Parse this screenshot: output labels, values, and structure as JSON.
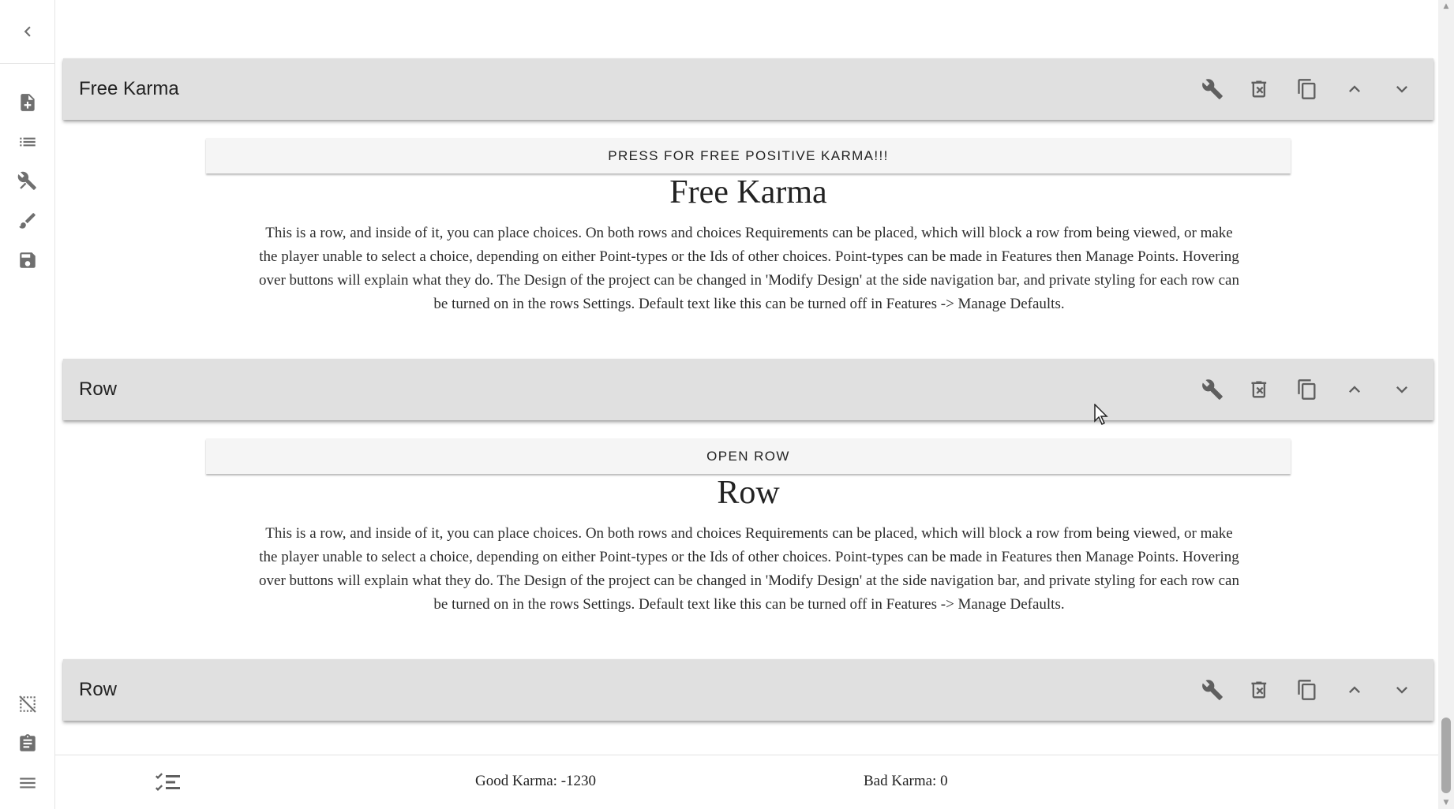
{
  "sidebar": {
    "collapse_icon": "chevron-left-icon",
    "items": [
      {
        "name": "create-project",
        "icon": "note-add-icon"
      },
      {
        "name": "row-list",
        "icon": "list-icon"
      },
      {
        "name": "features",
        "icon": "tools-icon"
      },
      {
        "name": "modify-design",
        "icon": "brush-icon"
      },
      {
        "name": "save",
        "icon": "save-icon"
      }
    ],
    "bottom_items": [
      {
        "name": "hide-images",
        "icon": "image-off-icon"
      },
      {
        "name": "clipboard",
        "icon": "clipboard-icon"
      },
      {
        "name": "menu",
        "icon": "menu-icon"
      }
    ]
  },
  "rows": [
    {
      "title": "Free Karma",
      "button_label": "PRESS FOR FREE POSITIVE KARMA!!!",
      "heading": "Free Karma",
      "text": "This is a row, and inside of it, you can place choices. On both rows and choices Requirements can be placed, which will block a row from being viewed, or make the player unable to select a choice, depending on either Point-types or the Ids of other choices. Point-types can be made in Features then Manage Points. Hovering over buttons will explain what they do. The Design of the project can be changed in 'Modify Design' at the side navigation bar, and private styling for each row can be turned on in the rows Settings. Default text like this can be turned off in Features -> Manage Defaults."
    },
    {
      "title": "Row",
      "button_label": "OPEN ROW",
      "heading": "Row",
      "text": "This is a row, and inside of it, you can place choices. On both rows and choices Requirements can be placed, which will block a row from being viewed, or make the player unable to select a choice, depending on either Point-types or the Ids of other choices. Point-types can be made in Features then Manage Points. Hovering over buttons will explain what they do. The Design of the project can be changed in 'Modify Design' at the side navigation bar, and private styling for each row can be turned on in the rows Settings. Default text like this can be turned off in Features -> Manage Defaults."
    },
    {
      "title": "Row"
    }
  ],
  "row_action_icons": [
    "wrench-icon",
    "delete-icon",
    "copy-icon",
    "chevron-up-icon",
    "chevron-down-icon"
  ],
  "status": {
    "points_icon": "checklist-icon",
    "good_karma": "Good Karma: -1230",
    "bad_karma": "Bad Karma: 0"
  },
  "colors": {
    "row_header_bg": "#e0e0e0",
    "row_button_bg": "#f5f5f5",
    "icon": "#5f5f5f"
  }
}
